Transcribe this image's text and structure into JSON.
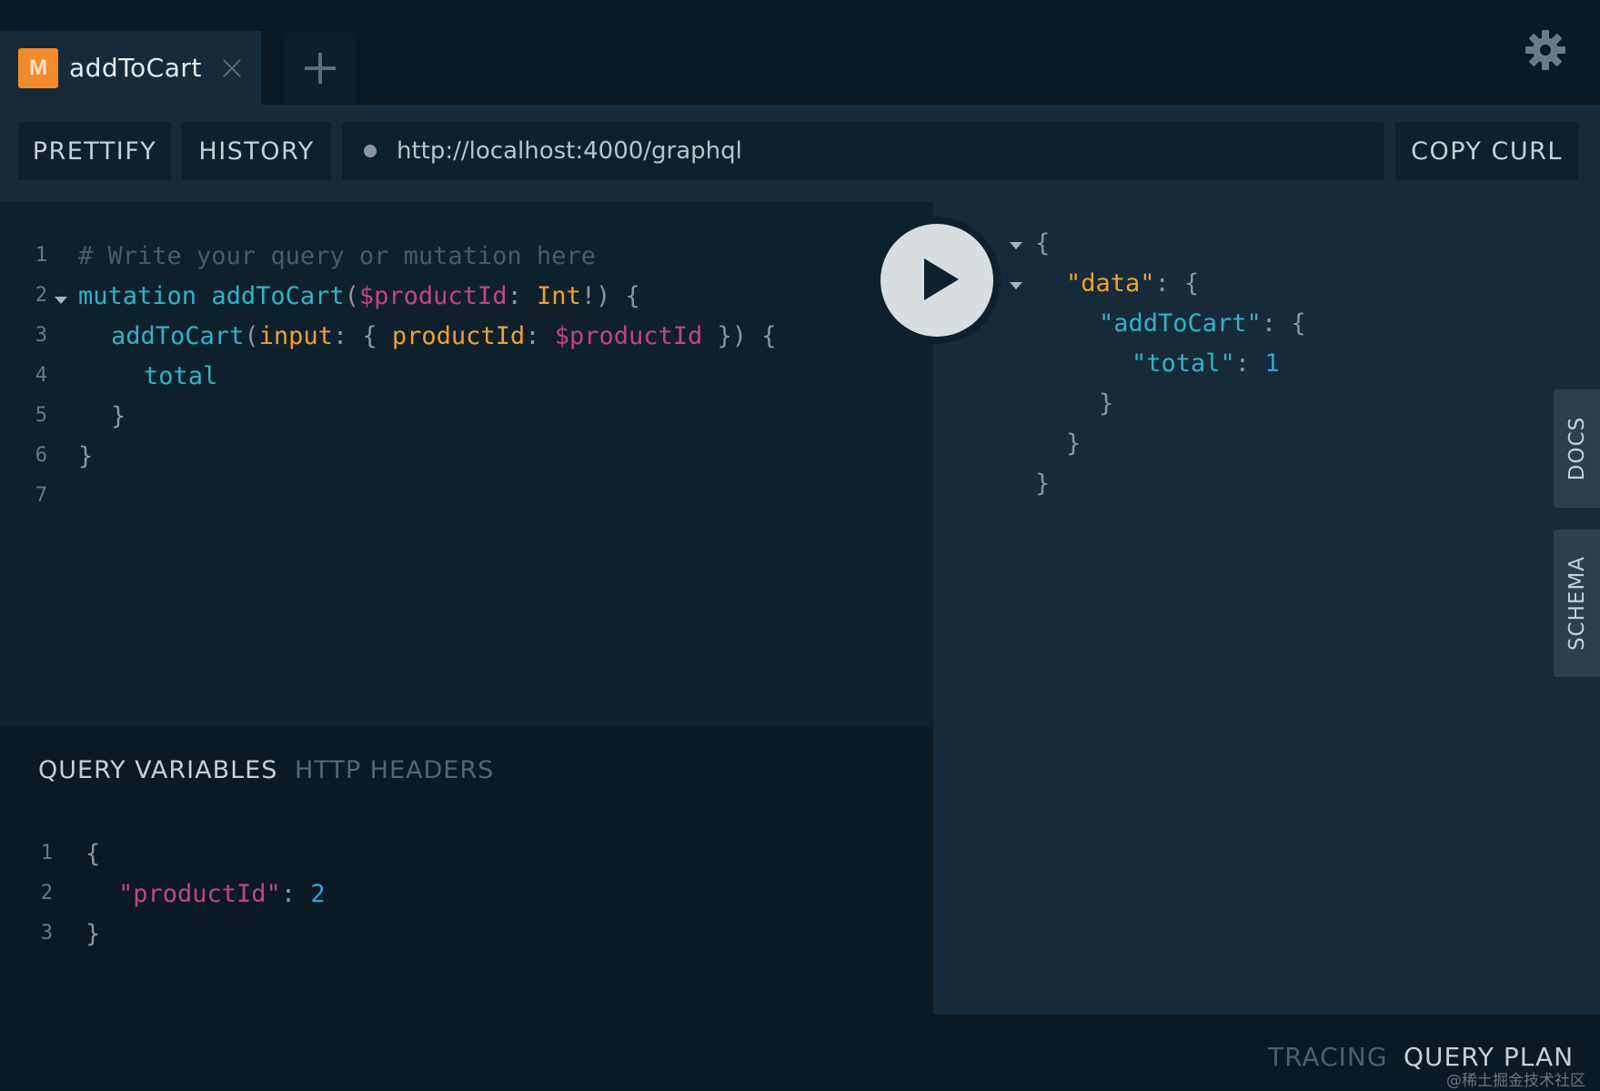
{
  "tabs": [
    {
      "badge": "M",
      "title": "addToCart"
    }
  ],
  "toolbar": {
    "prettify_label": "PRETTIFY",
    "history_label": "HISTORY",
    "url": "http://localhost:4000/graphql",
    "copy_curl_label": "COPY CURL"
  },
  "query_editor": {
    "line_numbers": [
      "1",
      "2",
      "3",
      "4",
      "5",
      "6",
      "7"
    ],
    "lines": {
      "l1": "# Write your query or mutation here",
      "l2_kw": "mutation",
      "l2_name": "addToCart",
      "l2_p1": "(",
      "l2_var": "$productId",
      "l2_colon": ": ",
      "l2_type": "Int",
      "l2_end": "!) {",
      "l3_field": "addToCart",
      "l3_p1": "(",
      "l3_arg": "input",
      "l3_p2": ": { ",
      "l3_key": "productId",
      "l3_p3": ": ",
      "l3_var": "$productId",
      "l3_end": " }) {",
      "l4": "total",
      "l5": "}",
      "l6": "}"
    }
  },
  "variables_pane": {
    "tab_active": "QUERY VARIABLES",
    "tab_inactive": "HTTP HEADERS",
    "line_numbers": [
      "1",
      "2",
      "3"
    ],
    "l1": "{",
    "l2_key": "\"productId\"",
    "l2_colon": ": ",
    "l2_val": "2",
    "l3": "}"
  },
  "result": {
    "r1": "{",
    "r2_key": "\"data\"",
    "r2_rest": ": {",
    "r3_key": "\"addToCart\"",
    "r3_rest": ": {",
    "r4_key": "\"total\"",
    "r4_colon": ": ",
    "r4_val": "1",
    "r5": "}",
    "r6": "}",
    "r7": "}"
  },
  "side_tabs": {
    "docs": "DOCS",
    "schema": "SCHEMA"
  },
  "bottom_tabs": {
    "tracing": "TRACING",
    "query_plan": "QUERY PLAN"
  },
  "watermark": "@稀土掘金技术社区"
}
